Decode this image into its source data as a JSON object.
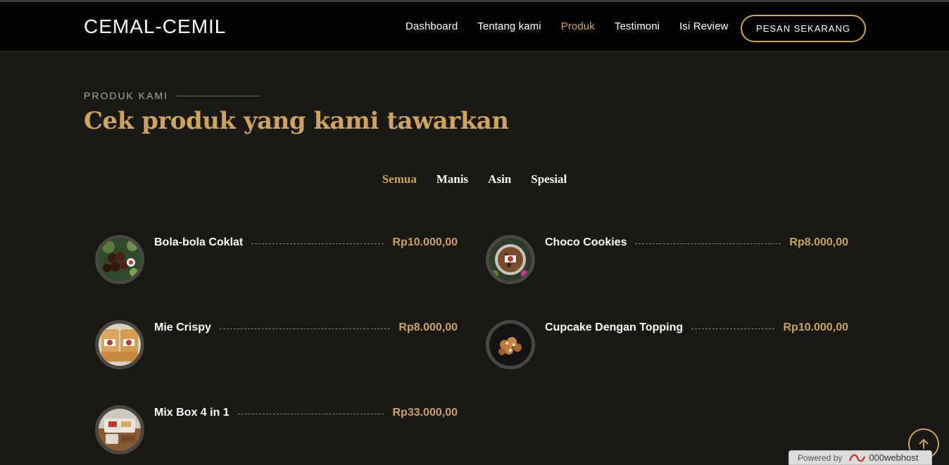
{
  "header": {
    "logo": "CEMAL-CEMIL",
    "nav": [
      "Dashboard",
      "Tentang kami",
      "Produk",
      "Testimoni",
      "Isi Review"
    ],
    "active_nav": "Produk",
    "cta_label": "PESAN SEKARANG"
  },
  "section": {
    "label": "PRODUK KAMI",
    "title": "Cek produk yang kami tawarkan"
  },
  "filters": {
    "items": [
      "Semua",
      "Manis",
      "Asin",
      "Spesial"
    ],
    "active": "Semua"
  },
  "products": [
    {
      "name": "Bola-bola Coklat",
      "price": "Rp10.000,00"
    },
    {
      "name": "Choco Cookies",
      "price": "Rp8.000,00"
    },
    {
      "name": "Mie Crispy",
      "price": "Rp8.000,00"
    },
    {
      "name": "Cupcake Dengan Topping",
      "price": "Rp10.000,00"
    },
    {
      "name": "Mix Box 4 in 1",
      "price": "Rp33.000,00"
    }
  ],
  "footer": {
    "powered_by": "Powered by",
    "host_brand": "000webhost"
  },
  "colors": {
    "accent": "#cda45e",
    "background": "#1a1814",
    "topbar": "#020202"
  },
  "icons": {
    "back_to_top": "arrow-up-icon",
    "host_logo": "webhost-logo-icon"
  }
}
